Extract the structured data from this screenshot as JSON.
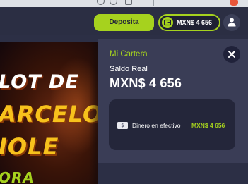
{
  "header": {
    "deposit_label": "Deposita",
    "balance": "MXN$ 4 656"
  },
  "banner": {
    "line1": "LOT DE",
    "line2": "ARCELO",
    "line3": "IOLE",
    "line4": "ORA"
  },
  "wallet_panel": {
    "title": "Mi Cartera",
    "subtitle": "Saldo Real",
    "amount": "MXN$ 4 656",
    "cash_label": "Dinero en efectivo",
    "cash_value": "MXN$ 4 656"
  },
  "colors": {
    "accent": "#a6d21e",
    "panel_bg": "#3a3d56",
    "card_bg": "#24263a",
    "header_bg": "#2b2e43"
  },
  "icons": [
    "wallet-icon",
    "user-icon",
    "close-icon",
    "cash-bill-icon"
  ]
}
